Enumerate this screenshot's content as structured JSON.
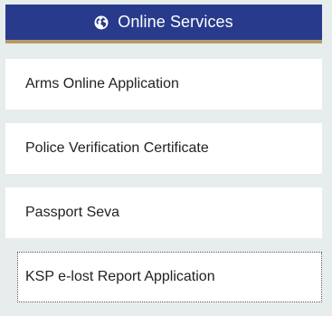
{
  "header": {
    "icon": "globe-icon",
    "title": "Online Services",
    "colors": {
      "background": "#283a8c",
      "accent_border": "#b79a6a",
      "text": "#ffffff"
    }
  },
  "services": [
    {
      "label": "Arms Online Application"
    },
    {
      "label": "Police Verification Certificate"
    },
    {
      "label": "Passport Seva"
    },
    {
      "label": "KSP e-lost Report Application"
    }
  ],
  "page": {
    "background": "#e7ecec"
  }
}
